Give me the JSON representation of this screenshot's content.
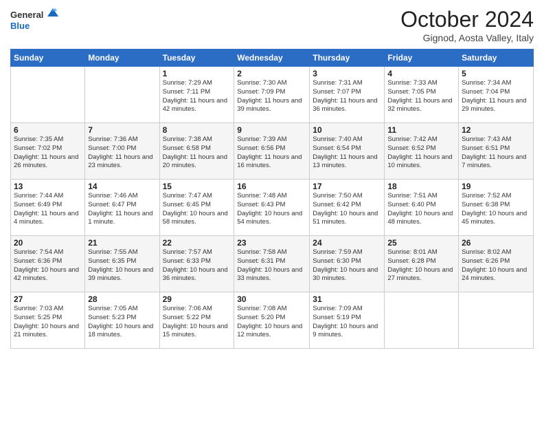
{
  "header": {
    "logo_line1": "General",
    "logo_line2": "Blue",
    "month_title": "October 2024",
    "location": "Gignod, Aosta Valley, Italy"
  },
  "days_of_week": [
    "Sunday",
    "Monday",
    "Tuesday",
    "Wednesday",
    "Thursday",
    "Friday",
    "Saturday"
  ],
  "weeks": [
    [
      {
        "day": "",
        "sunrise": "",
        "sunset": "",
        "daylight": ""
      },
      {
        "day": "",
        "sunrise": "",
        "sunset": "",
        "daylight": ""
      },
      {
        "day": "1",
        "sunrise": "Sunrise: 7:29 AM",
        "sunset": "Sunset: 7:11 PM",
        "daylight": "Daylight: 11 hours and 42 minutes."
      },
      {
        "day": "2",
        "sunrise": "Sunrise: 7:30 AM",
        "sunset": "Sunset: 7:09 PM",
        "daylight": "Daylight: 11 hours and 39 minutes."
      },
      {
        "day": "3",
        "sunrise": "Sunrise: 7:31 AM",
        "sunset": "Sunset: 7:07 PM",
        "daylight": "Daylight: 11 hours and 36 minutes."
      },
      {
        "day": "4",
        "sunrise": "Sunrise: 7:33 AM",
        "sunset": "Sunset: 7:05 PM",
        "daylight": "Daylight: 11 hours and 32 minutes."
      },
      {
        "day": "5",
        "sunrise": "Sunrise: 7:34 AM",
        "sunset": "Sunset: 7:04 PM",
        "daylight": "Daylight: 11 hours and 29 minutes."
      }
    ],
    [
      {
        "day": "6",
        "sunrise": "Sunrise: 7:35 AM",
        "sunset": "Sunset: 7:02 PM",
        "daylight": "Daylight: 11 hours and 26 minutes."
      },
      {
        "day": "7",
        "sunrise": "Sunrise: 7:36 AM",
        "sunset": "Sunset: 7:00 PM",
        "daylight": "Daylight: 11 hours and 23 minutes."
      },
      {
        "day": "8",
        "sunrise": "Sunrise: 7:38 AM",
        "sunset": "Sunset: 6:58 PM",
        "daylight": "Daylight: 11 hours and 20 minutes."
      },
      {
        "day": "9",
        "sunrise": "Sunrise: 7:39 AM",
        "sunset": "Sunset: 6:56 PM",
        "daylight": "Daylight: 11 hours and 16 minutes."
      },
      {
        "day": "10",
        "sunrise": "Sunrise: 7:40 AM",
        "sunset": "Sunset: 6:54 PM",
        "daylight": "Daylight: 11 hours and 13 minutes."
      },
      {
        "day": "11",
        "sunrise": "Sunrise: 7:42 AM",
        "sunset": "Sunset: 6:52 PM",
        "daylight": "Daylight: 11 hours and 10 minutes."
      },
      {
        "day": "12",
        "sunrise": "Sunrise: 7:43 AM",
        "sunset": "Sunset: 6:51 PM",
        "daylight": "Daylight: 11 hours and 7 minutes."
      }
    ],
    [
      {
        "day": "13",
        "sunrise": "Sunrise: 7:44 AM",
        "sunset": "Sunset: 6:49 PM",
        "daylight": "Daylight: 11 hours and 4 minutes."
      },
      {
        "day": "14",
        "sunrise": "Sunrise: 7:46 AM",
        "sunset": "Sunset: 6:47 PM",
        "daylight": "Daylight: 11 hours and 1 minute."
      },
      {
        "day": "15",
        "sunrise": "Sunrise: 7:47 AM",
        "sunset": "Sunset: 6:45 PM",
        "daylight": "Daylight: 10 hours and 58 minutes."
      },
      {
        "day": "16",
        "sunrise": "Sunrise: 7:48 AM",
        "sunset": "Sunset: 6:43 PM",
        "daylight": "Daylight: 10 hours and 54 minutes."
      },
      {
        "day": "17",
        "sunrise": "Sunrise: 7:50 AM",
        "sunset": "Sunset: 6:42 PM",
        "daylight": "Daylight: 10 hours and 51 minutes."
      },
      {
        "day": "18",
        "sunrise": "Sunrise: 7:51 AM",
        "sunset": "Sunset: 6:40 PM",
        "daylight": "Daylight: 10 hours and 48 minutes."
      },
      {
        "day": "19",
        "sunrise": "Sunrise: 7:52 AM",
        "sunset": "Sunset: 6:38 PM",
        "daylight": "Daylight: 10 hours and 45 minutes."
      }
    ],
    [
      {
        "day": "20",
        "sunrise": "Sunrise: 7:54 AM",
        "sunset": "Sunset: 6:36 PM",
        "daylight": "Daylight: 10 hours and 42 minutes."
      },
      {
        "day": "21",
        "sunrise": "Sunrise: 7:55 AM",
        "sunset": "Sunset: 6:35 PM",
        "daylight": "Daylight: 10 hours and 39 minutes."
      },
      {
        "day": "22",
        "sunrise": "Sunrise: 7:57 AM",
        "sunset": "Sunset: 6:33 PM",
        "daylight": "Daylight: 10 hours and 36 minutes."
      },
      {
        "day": "23",
        "sunrise": "Sunrise: 7:58 AM",
        "sunset": "Sunset: 6:31 PM",
        "daylight": "Daylight: 10 hours and 33 minutes."
      },
      {
        "day": "24",
        "sunrise": "Sunrise: 7:59 AM",
        "sunset": "Sunset: 6:30 PM",
        "daylight": "Daylight: 10 hours and 30 minutes."
      },
      {
        "day": "25",
        "sunrise": "Sunrise: 8:01 AM",
        "sunset": "Sunset: 6:28 PM",
        "daylight": "Daylight: 10 hours and 27 minutes."
      },
      {
        "day": "26",
        "sunrise": "Sunrise: 8:02 AM",
        "sunset": "Sunset: 6:26 PM",
        "daylight": "Daylight: 10 hours and 24 minutes."
      }
    ],
    [
      {
        "day": "27",
        "sunrise": "Sunrise: 7:03 AM",
        "sunset": "Sunset: 5:25 PM",
        "daylight": "Daylight: 10 hours and 21 minutes."
      },
      {
        "day": "28",
        "sunrise": "Sunrise: 7:05 AM",
        "sunset": "Sunset: 5:23 PM",
        "daylight": "Daylight: 10 hours and 18 minutes."
      },
      {
        "day": "29",
        "sunrise": "Sunrise: 7:06 AM",
        "sunset": "Sunset: 5:22 PM",
        "daylight": "Daylight: 10 hours and 15 minutes."
      },
      {
        "day": "30",
        "sunrise": "Sunrise: 7:08 AM",
        "sunset": "Sunset: 5:20 PM",
        "daylight": "Daylight: 10 hours and 12 minutes."
      },
      {
        "day": "31",
        "sunrise": "Sunrise: 7:09 AM",
        "sunset": "Sunset: 5:19 PM",
        "daylight": "Daylight: 10 hours and 9 minutes."
      },
      {
        "day": "",
        "sunrise": "",
        "sunset": "",
        "daylight": ""
      },
      {
        "day": "",
        "sunrise": "",
        "sunset": "",
        "daylight": ""
      }
    ]
  ]
}
